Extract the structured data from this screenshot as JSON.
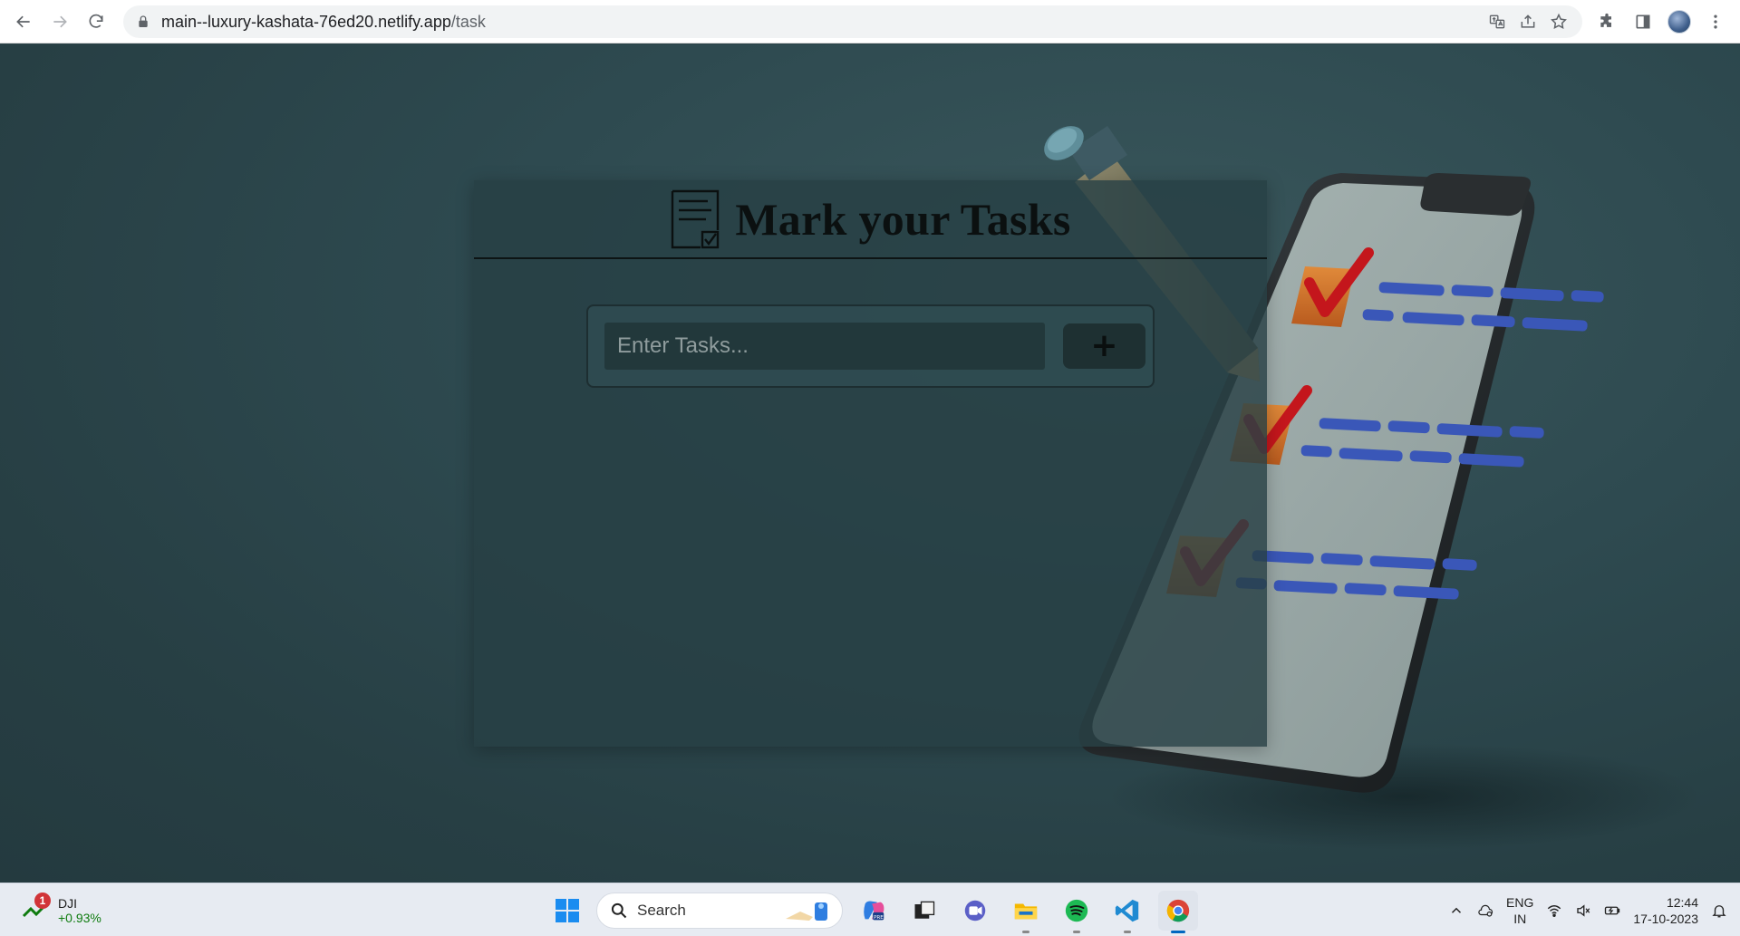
{
  "browser": {
    "url_host": "main--luxury-kashata-76ed20.netlify.app",
    "url_path": "/task"
  },
  "page": {
    "title": "Mark your Tasks",
    "input_placeholder": "Enter Tasks...",
    "input_value": "",
    "add_button_label": "+"
  },
  "taskbar": {
    "stock_name": "DJI",
    "stock_change": "+0.93%",
    "stock_badge": "1",
    "search_label": "Search",
    "apps": [
      "copilot-icon",
      "file-manager-icon",
      "teams-icon",
      "file-explorer-icon",
      "spotify-icon",
      "vscode-icon",
      "chrome-icon"
    ],
    "lang_top": "ENG",
    "lang_bottom": "IN",
    "time": "12:44",
    "date": "17-10-2023"
  },
  "colors": {
    "page_bg": "#2b4348",
    "card_bg": "#274044",
    "accent_blue": "#3a57b8",
    "check_red": "#c4161c",
    "check_box_orange": "#d9792a"
  }
}
